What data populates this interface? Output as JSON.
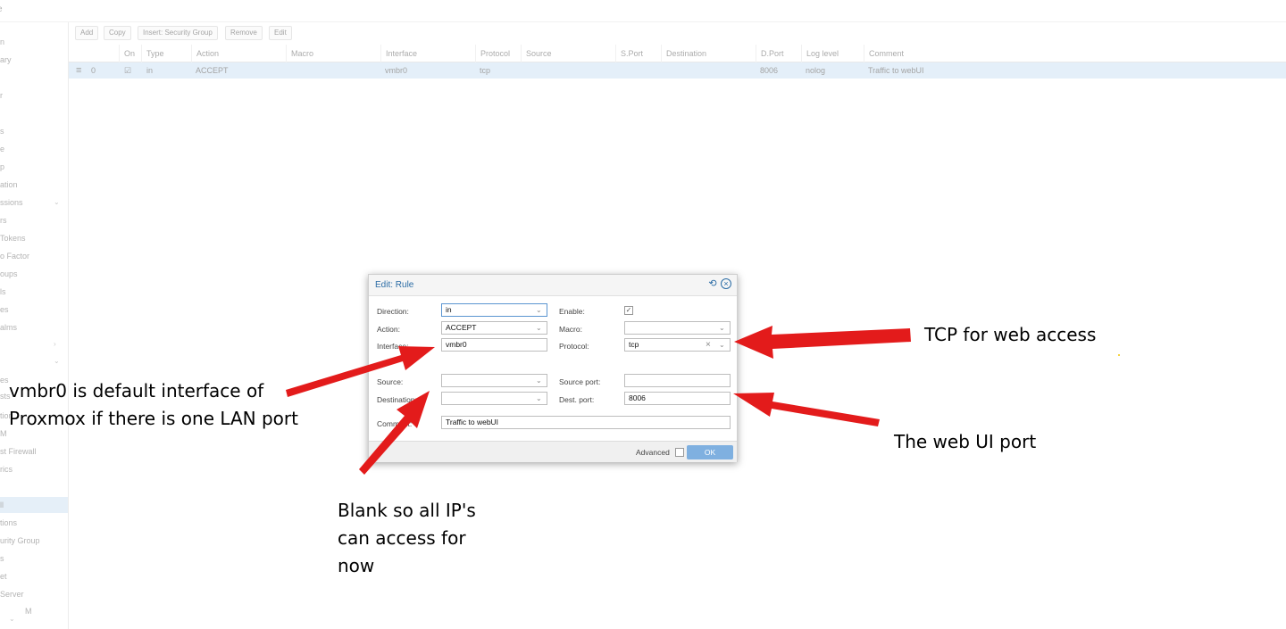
{
  "window": {
    "title_fragment": "e"
  },
  "sidebar": {
    "items": [
      "n",
      "ary",
      "r",
      "s",
      "e",
      "p",
      "ation",
      "ssions",
      "rs",
      "Tokens",
      "o Factor",
      "oups",
      "ls",
      "es",
      "alms",
      "es",
      "sts",
      "tion",
      "M",
      "st Firewall",
      "rics",
      "ll",
      "tions",
      "urity Group",
      "s",
      "et",
      "Server",
      "M"
    ],
    "selected_index": 21
  },
  "toolbar": {
    "buttons": [
      "Add",
      "Copy",
      "Insert: Security Group",
      "Remove",
      "Edit"
    ]
  },
  "grid": {
    "columns": [
      "On",
      "Type",
      "Action",
      "Macro",
      "Interface",
      "Protocol",
      "Source",
      "S.Port",
      "Destination",
      "D.Port",
      "Log level",
      "Comment"
    ],
    "rows": [
      {
        "handle_icon": "drag-handle-icon",
        "pos": "0",
        "on": "☑",
        "type": "in",
        "action": "ACCEPT",
        "macro": "",
        "interface": "vmbr0",
        "protocol": "tcp",
        "source": "",
        "sport": "",
        "destination": "",
        "dport": "8006",
        "log": "nolog",
        "comment": "Traffic to webUI"
      }
    ]
  },
  "dialog": {
    "title": "Edit: Rule",
    "icons": [
      "reset-icon",
      "close-icon"
    ],
    "labels": {
      "direction": "Direction:",
      "action": "Action:",
      "interface": "Interface:",
      "source": "Source:",
      "destination": "Destination:",
      "comment": "Comment:",
      "enable": "Enable:",
      "macro": "Macro:",
      "protocol": "Protocol:",
      "source_port": "Source port:",
      "dest_port": "Dest. port:"
    },
    "values": {
      "direction": "in",
      "action": "ACCEPT",
      "interface": "vmbr0",
      "source": "",
      "destination": "",
      "comment": "Traffic to webUI",
      "enable": true,
      "macro": "",
      "protocol": "tcp",
      "source_port": "",
      "dest_port": "8006"
    },
    "footer": {
      "advanced_label": "Advanced",
      "advanced_checked": false,
      "ok_label": "OK"
    }
  },
  "annotations": {
    "protocol_note": "TCP for web access",
    "port_note": "The web UI port",
    "interface_note_line1": "vmbr0 is default interface of",
    "interface_note_line2": "Proxmox if there is one LAN port",
    "source_note_line1": "Blank so all IP's",
    "source_note_line2": "can access for",
    "source_note_line3": "now",
    "arrow_color": "#e31b1b"
  }
}
